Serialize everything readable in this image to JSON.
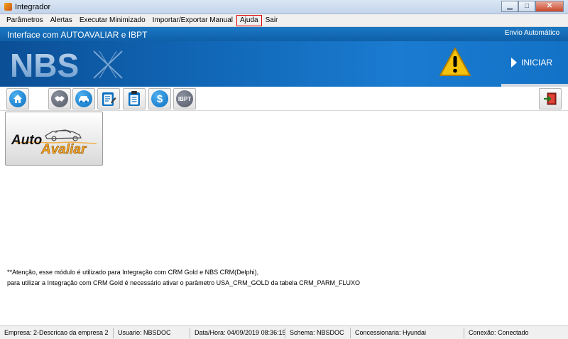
{
  "window": {
    "title": "Integrador",
    "minimize_glyph": "▁",
    "maximize_glyph": "□",
    "close_glyph": "✕"
  },
  "menu": [
    {
      "label": "Parâmetros"
    },
    {
      "label": "Alertas"
    },
    {
      "label": "Executar Minimizado"
    },
    {
      "label": "Importar/Exportar Manual"
    },
    {
      "label": "Ajuda"
    },
    {
      "label": "Sair"
    }
  ],
  "header": {
    "title": "Interface com AUTOAVALIAR e IBPT",
    "right_text": "Envio Automático"
  },
  "banner": {
    "logo_text": "NBS",
    "start_label": "INICIAR"
  },
  "toolbar": {
    "icons": [
      "home-icon",
      "handshake-icon",
      "car-icon",
      "form-edit-icon",
      "clipboard-icon",
      "dollar-icon",
      "ibpt-icon",
      "exit-icon"
    ],
    "ibpt_label": "IBPT",
    "dollar_label": "$"
  },
  "modules": {
    "autoavaliar_line1": "Auto",
    "autoavaliar_line2": "Avaliar"
  },
  "notes": [
    "**Atenção, esse módulo é utilizado para Integração com CRM Gold e NBS CRM(Delphi),",
    "para utilizar a Integração com CRM Gold é necessário ativar o parâmetro USA_CRM_GOLD da tabela CRM_PARM_FLUXO"
  ],
  "status": {
    "empresa": "Empresa: 2-Descricao da empresa 2",
    "usuario": "Usuario: NBSDOC",
    "datahora": "Data/Hora: 04/09/2019 08:36:15",
    "schema": "Schema: NBSDOC",
    "concessionaria": "Concessionaria: Hyundai",
    "conexao": "Conexão: Conectado"
  },
  "colors": {
    "header_blue": "#0f5fa8",
    "banner_blue": "#1166b5",
    "warning_yellow": "#f4c20d",
    "icon_blue": "#0a6fc0"
  }
}
